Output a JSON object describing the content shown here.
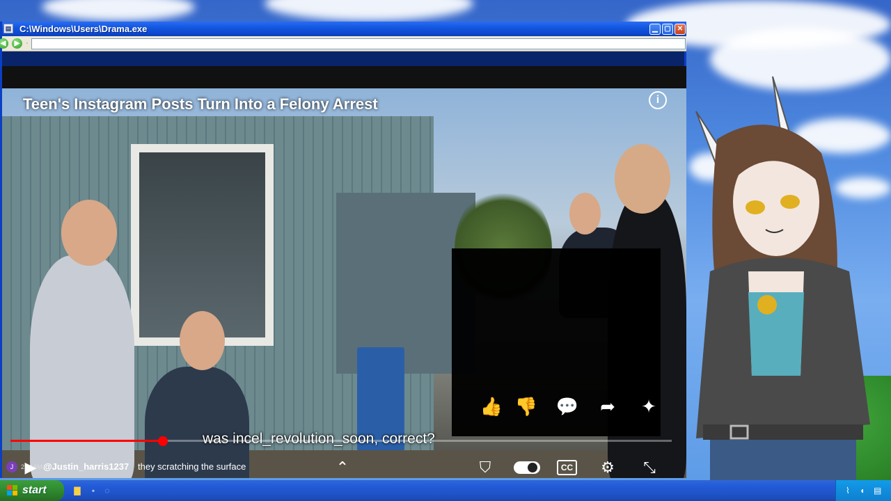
{
  "window": {
    "title": "C:\\Windows\\Users\\Drama.exe",
    "minimize_icon": "minimize-icon",
    "maximize_icon": "maximize-icon",
    "close_icon": "close-icon",
    "address_value": ""
  },
  "video": {
    "title": "Teen's Instagram Posts Turn Into a Felony Arrest",
    "subtitle": "was incel_revolution_soon, correct?",
    "progress": 0.23,
    "actions": [
      {
        "name": "like-icon",
        "glyph": "👍"
      },
      {
        "name": "dislike-icon",
        "glyph": "👎"
      },
      {
        "name": "comments-icon",
        "glyph": "💬"
      },
      {
        "name": "share-icon",
        "glyph": "➦"
      },
      {
        "name": "remix-icon",
        "glyph": "✦"
      }
    ],
    "controls": {
      "cc_label": "CC"
    }
  },
  "chat": {
    "avatar_initial": "J",
    "time": "2:21AM",
    "user": "@Justin_harris1237",
    "message": "they scratching the surface"
  },
  "taskbar": {
    "start_label": "start"
  },
  "colors": {
    "accent": "#ff0000",
    "titlebar": "#0d48cf",
    "start_green": "#2f8a2f"
  }
}
